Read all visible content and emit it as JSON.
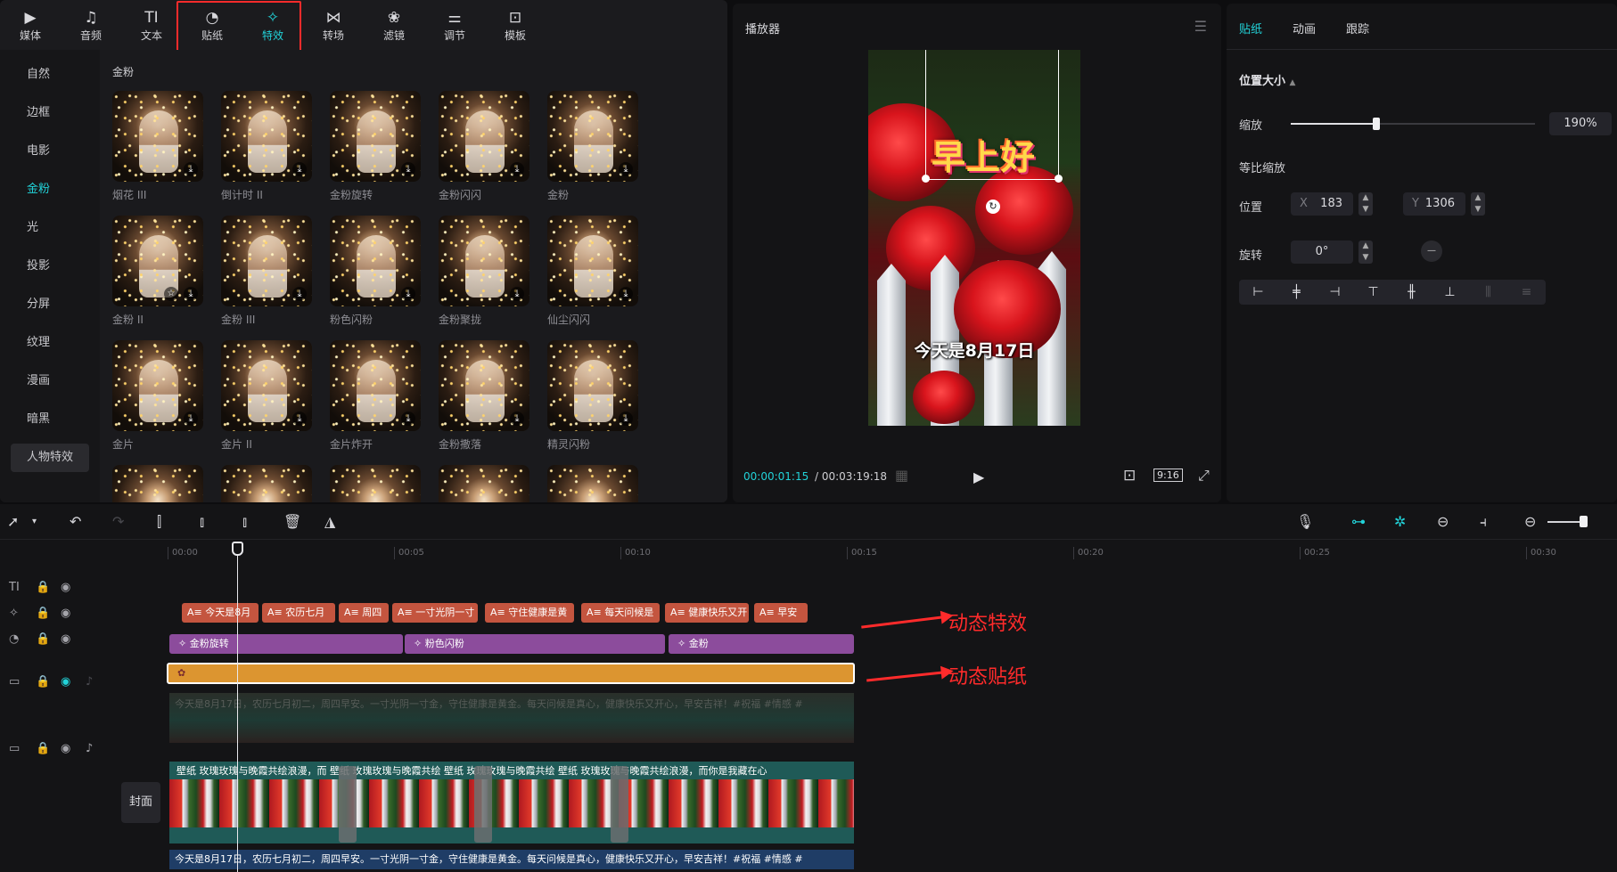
{
  "toolbar": {
    "tools": [
      {
        "label": "媒体",
        "icon": "media-icon",
        "glyph": "▶"
      },
      {
        "label": "音频",
        "icon": "audio-icon",
        "glyph": "♫"
      },
      {
        "label": "文本",
        "icon": "text-icon",
        "glyph": "TI"
      },
      {
        "label": "贴纸",
        "icon": "sticker-icon",
        "glyph": "◔"
      },
      {
        "label": "特效",
        "icon": "effects-icon",
        "glyph": "✧"
      },
      {
        "label": "转场",
        "icon": "transition-icon",
        "glyph": "⋈"
      },
      {
        "label": "滤镜",
        "icon": "filter-icon",
        "glyph": "❀"
      },
      {
        "label": "调节",
        "icon": "adjust-icon",
        "glyph": "⚌"
      },
      {
        "label": "模板",
        "icon": "template-icon",
        "glyph": "⊡"
      }
    ],
    "active": "特效",
    "accent": "#22d3d9",
    "highlight": "#ff2b2b"
  },
  "categories": {
    "items": [
      "自然",
      "边框",
      "电影",
      "金粉",
      "光",
      "投影",
      "分屏",
      "纹理",
      "漫画",
      "暗黑"
    ],
    "active": "金粉",
    "pill": "人物特效"
  },
  "library": {
    "section_title": "金粉",
    "items": [
      "烟花 III",
      "倒计时 II",
      "金粉旋转",
      "金粉闪闪",
      "金粉",
      "金粉 II",
      "金粉 III",
      "粉色闪粉",
      "金粉聚拢",
      "仙尘闪闪",
      "金片",
      "金片 II",
      "金片炸开",
      "金粉撒落",
      "精灵闪粉"
    ]
  },
  "player": {
    "title": "播放器",
    "sticker_text": "早上好",
    "caption": "今天是8月17日",
    "current_time": "00:00:01:15",
    "total_time": "00:03:19:18",
    "ratio": "9:16"
  },
  "props": {
    "tabs": [
      "贴纸",
      "动画",
      "跟踪"
    ],
    "active_tab": "贴纸",
    "section": "位置大小",
    "scale_label": "缩放",
    "scale_value": "190%",
    "scale_fraction": 0.35,
    "uniform_label": "等比缩放",
    "position_label": "位置",
    "x_label": "X",
    "x_value": "183",
    "y_label": "Y",
    "y_value": "1306",
    "rotation_label": "旋转",
    "rotation_value": "0°"
  },
  "timeline": {
    "ruler": [
      "00:00",
      "00:05",
      "00:10",
      "00:15",
      "00:20",
      "00:25",
      "00:30"
    ],
    "text_clips": [
      "A≡ 今天是8月",
      "A≡ 农历七月",
      "A≡ 周四",
      "A≡ 一寸光阴一寸",
      "A≡ 守住健康是黄",
      "A≡ 每天问候是",
      "A≡ 健康快乐又开",
      "A≡ 早安"
    ],
    "fx_clips": [
      "✧ 金粉旋转",
      "✧ 粉色闪粉",
      "✧ 金粉"
    ],
    "sticker_clip_mark": "✿",
    "overlay_text": "今天是8月17日，农历七月初二，周四早安。一寸光阴一寸金，守住健康是黄金。每天问候是真心，健康快乐又开心，早安吉祥！#祝福 #情感 #",
    "main_clip_text": "壁纸  玫瑰玫瑰与晚霞共绘浪漫，而  壁纸  玫瑰玫瑰与晚霞共绘  壁纸  玫瑰玫瑰与晚霞共绘  壁纸  玫瑰玫瑰与晚霞共绘浪漫，而你是我藏在心",
    "subtitle_text": "今天是8月17日，农历七月初二，周四早安。一寸光阴一寸金，守住健康是黄金。每天问候是真心，健康快乐又开心，早安吉祥！#祝福 #情感 #",
    "cover_label": "封面"
  },
  "annotations": {
    "effects": "动态特效",
    "sticker": "动态贴纸"
  }
}
